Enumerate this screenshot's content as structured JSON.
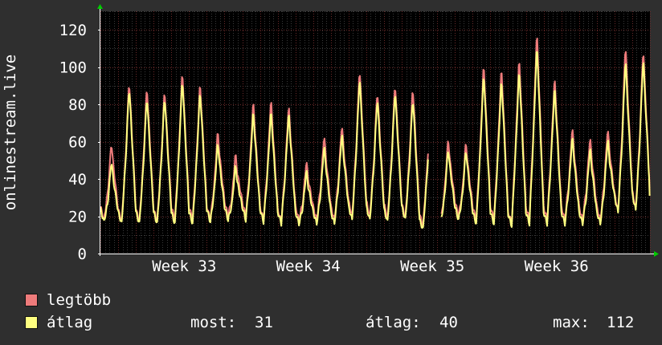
{
  "colors": {
    "background": "#2f2f2f",
    "plot_background": "#000000",
    "grid_major": "#6b2a2a",
    "grid_minor": "#3a3a3a",
    "axis": "#ffffff",
    "arrow": "#00cc00",
    "series_max": "#ee7b7b",
    "series_avg": "#ffff80"
  },
  "legend": {
    "items": [
      {
        "label": "legtöbb",
        "color": "#ee7b7b"
      },
      {
        "label": "átlag",
        "color": "#ffff80"
      }
    ]
  },
  "stats": {
    "now_label": "most:",
    "now_value": "31",
    "avg_label": "átlag:",
    "avg_value": "40",
    "max_label": "max:",
    "max_value": "112"
  },
  "chart_data": {
    "type": "line",
    "ylabel": "onlinestream.live",
    "ylim": [
      0,
      130
    ],
    "yticks": [
      0,
      20,
      40,
      60,
      80,
      100,
      120
    ],
    "xlim": [
      0,
      31
    ],
    "xtick_labels": [
      {
        "label": "Week 33",
        "x": 4.0
      },
      {
        "label": "Week 34",
        "x": 11.0
      },
      {
        "label": "Week 35",
        "x": 18.0
      },
      {
        "label": "Week 36",
        "x": 25.0
      }
    ],
    "grid": true,
    "days": 31,
    "gaps": [
      {
        "from": 18.5,
        "to": 19.2
      }
    ],
    "series": [
      {
        "name": "legtöbb",
        "color": "#ee7b7b",
        "peaks": [
          60,
          93,
          90,
          88,
          98,
          92,
          66,
          54,
          82,
          83,
          80,
          50,
          64,
          70,
          100,
          88,
          92,
          90,
          80,
          62,
          60,
          102,
          100,
          105,
          119,
          95,
          68,
          63,
          68,
          113,
          111
        ],
        "troughs": [
          18,
          17,
          17,
          17,
          18,
          18,
          18,
          20,
          20,
          18,
          17,
          18,
          18,
          18,
          20,
          20,
          19,
          19,
          15,
          17,
          20,
          18,
          18,
          16,
          18,
          18,
          18,
          18,
          18,
          23,
          24
        ],
        "last": 31
      },
      {
        "name": "átlag",
        "color": "#ffff80",
        "peaks": [
          50,
          90,
          85,
          85,
          94,
          88,
          60,
          48,
          77,
          77,
          76,
          45,
          58,
          65,
          95,
          84,
          88,
          84,
          75,
          57,
          56,
          97,
          94,
          99,
          112,
          90,
          63,
          57,
          62,
          105,
          106
        ],
        "troughs": [
          17,
          16,
          16,
          16,
          16,
          16,
          17,
          18,
          18,
          17,
          16,
          16,
          16,
          16,
          18,
          18,
          17,
          18,
          13,
          16,
          18,
          16,
          16,
          15,
          16,
          16,
          16,
          16,
          16,
          22,
          23
        ],
        "last": 31
      }
    ]
  }
}
